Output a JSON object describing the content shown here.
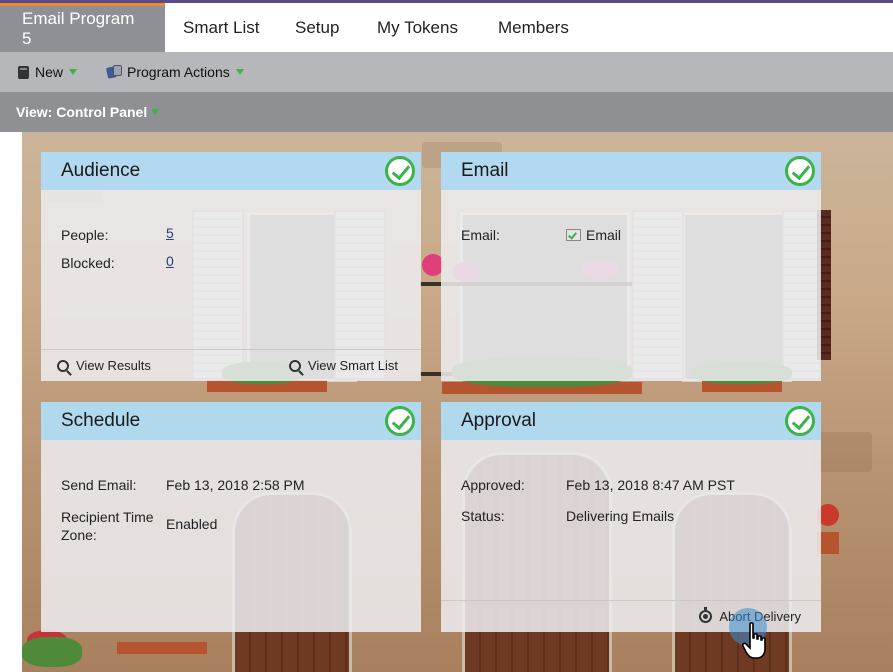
{
  "tabs": [
    {
      "label": "Email Program 5",
      "active": true
    },
    {
      "label": "Smart List",
      "active": false
    },
    {
      "label": "Setup",
      "active": false
    },
    {
      "label": "My Tokens",
      "active": false
    },
    {
      "label": "Members",
      "active": false
    }
  ],
  "toolbar": {
    "new_label": "New",
    "actions_label": "Program Actions"
  },
  "view": {
    "label": "View: Control Panel"
  },
  "audience": {
    "title": "Audience",
    "people_label": "People:",
    "people_value": "5",
    "blocked_label": "Blocked:",
    "blocked_value": "0",
    "view_results": "View Results",
    "view_smart_list": "View Smart List"
  },
  "email": {
    "title": "Email",
    "email_label": "Email:",
    "email_value": "Email"
  },
  "schedule": {
    "title": "Schedule",
    "send_label": "Send Email:",
    "send_value": "Feb 13, 2018 2:58 PM",
    "tz_label": "Recipient Time Zone:",
    "tz_value": "Enabled"
  },
  "approval": {
    "title": "Approval",
    "approved_label": "Approved:",
    "approved_value": "Feb 13, 2018 8:47 AM PST",
    "status_label": "Status:",
    "status_value": "Delivering Emails",
    "abort_label": "Abort Delivery"
  },
  "colors": {
    "accent_orange": "#f08a24",
    "check_green": "#3bb34a",
    "panel_header_blue": "#aad7f0"
  }
}
